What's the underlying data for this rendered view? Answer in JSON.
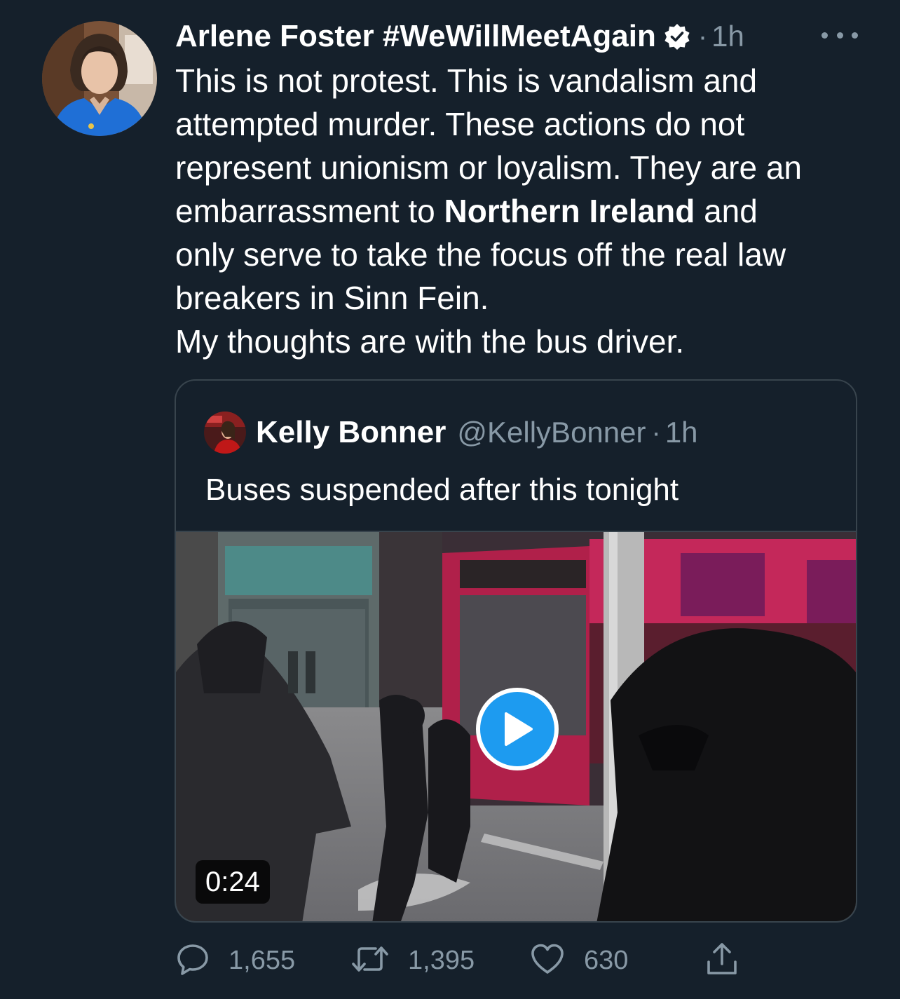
{
  "tweet": {
    "display_name": "Arlene Foster #WeWillMeetAgain",
    "verified_icon": "verified-badge-icon",
    "separator": "·",
    "time": "1h",
    "more_icon": "more-icon",
    "body": {
      "line1": "This is not protest. This is vandalism and",
      "line2": "attempted murder. These actions do not",
      "line3": "represent unionism or loyalism. They are an",
      "line4_pre": "embarrassment to ",
      "line4_bold": "Northern Ireland",
      "line4_post": " and",
      "line5": "only serve to take the focus off the real law",
      "line6": "breakers in Sinn Fein.",
      "line7": "My thoughts are with the bus driver."
    }
  },
  "quoted": {
    "display_name": "Kelly Bonner",
    "handle": "@KellyBonner",
    "separator": "·",
    "time": "1h",
    "text": "Buses suspended after this tonight",
    "video": {
      "duration": "0:24",
      "play_icon": "play-icon"
    }
  },
  "actions": {
    "reply": {
      "icon": "reply-icon",
      "count": "1,655"
    },
    "retweet": {
      "icon": "retweet-icon",
      "count": "1,395"
    },
    "like": {
      "icon": "heart-icon",
      "count": "630"
    },
    "share": {
      "icon": "share-icon"
    }
  },
  "colors": {
    "background": "#15202b",
    "secondary_text": "#8899a6",
    "border": "#38444d",
    "accent": "#1d9bf0"
  }
}
